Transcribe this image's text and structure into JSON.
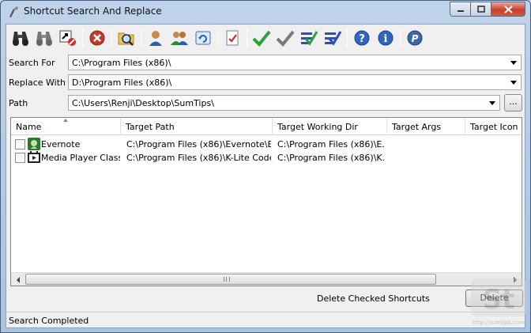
{
  "window": {
    "title": "Shortcut Search And Replace"
  },
  "toolbar": {
    "icons": [
      "binoculars-icon",
      "binoculars-gray-icon",
      "broken-shortcut-icon",
      "stop-icon",
      "folder-search-icon",
      "user-icon",
      "users-icon",
      "refresh-icon",
      "checklist-icon",
      "check-green-icon",
      "check-gray-icon",
      "check-all-icon",
      "uncheck-all-icon",
      "help-icon",
      "info-icon",
      "paypal-icon"
    ]
  },
  "form": {
    "search_for": {
      "label": "Search For",
      "value": "C:\\Program Files (x86)\\"
    },
    "replace_with": {
      "label": "Replace With",
      "value": "D:\\Program Files (x86)\\"
    },
    "path": {
      "label": "Path",
      "value": "C:\\Users\\Renji\\Desktop\\SumTips\\"
    },
    "browse_label": "..."
  },
  "table": {
    "columns": [
      "Name",
      "Target Path",
      "Target Working Dir",
      "Target Args",
      "Target Icon"
    ],
    "rows": [
      {
        "name": "Evernote",
        "target_path": "C:\\Program Files (x86)\\Evernote\\E...",
        "working_dir": "C:\\Program Files (x86)\\E...",
        "icon": "evernote-icon"
      },
      {
        "name": "Media Player Classic",
        "target_path": "C:\\Program Files (x86)\\K-Lite Code...",
        "working_dir": "C:\\Program Files (x86)\\K...",
        "icon": "media-player-icon"
      }
    ]
  },
  "actions": {
    "delete_checked_label": "Delete Checked Shortcuts",
    "delete_button": "Delete"
  },
  "status": {
    "text": "Search Completed"
  },
  "watermark": {
    "text": "St",
    "url": "http://sumtips.com"
  }
}
